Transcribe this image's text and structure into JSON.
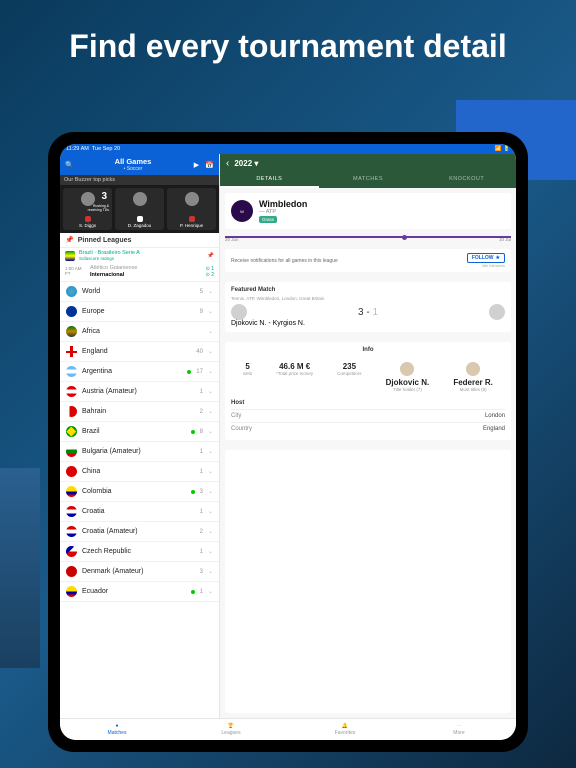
{
  "headline": "Find every tournament detail",
  "statusbar": {
    "time": "11:29 AM",
    "date": "Tue Sep 20"
  },
  "left": {
    "header": {
      "title": "All Games",
      "sub": "• Soccer"
    },
    "picks_label": "Our Buzzer top picks",
    "picks": [
      {
        "name": "S. Diggs",
        "badge": "3",
        "sub": "Rushing & receiving TDs",
        "crest": "#c33"
      },
      {
        "name": "D. Zagadou",
        "crest": "#fff"
      },
      {
        "name": "P. Henrique",
        "crest": "#c33"
      }
    ],
    "pinned_label": "Pinned Leagues",
    "pinned": {
      "country": "Brazil",
      "league": "Brasileiro Serie A",
      "src": "Sofascore ratings"
    },
    "match": {
      "time": "1:00 AM",
      "status": "FT",
      "home": "Atlético Goianiense",
      "away": "Internacional",
      "hs": "1",
      "as": "2"
    },
    "countries": [
      {
        "name": "World",
        "count": "5",
        "flag": "flag-world"
      },
      {
        "name": "Europe",
        "count": "9",
        "flag": "flag-eu"
      },
      {
        "name": "Africa",
        "count": "",
        "flag": "flag-af"
      },
      {
        "name": "England",
        "count": "40",
        "flag": "flag-en"
      },
      {
        "name": "Argentina",
        "count": "17",
        "flag": "flag-ar",
        "live": true
      },
      {
        "name": "Austria (Amateur)",
        "count": "1",
        "flag": "flag-at"
      },
      {
        "name": "Bahrain",
        "count": "2",
        "flag": "flag-bh"
      },
      {
        "name": "Brazil",
        "count": "8",
        "flag": "flag-br",
        "live": true
      },
      {
        "name": "Bulgaria (Amateur)",
        "count": "1",
        "flag": "flag-bg"
      },
      {
        "name": "China",
        "count": "1",
        "flag": "flag-cn"
      },
      {
        "name": "Colombia",
        "count": "3",
        "flag": "flag-co",
        "live": true
      },
      {
        "name": "Croatia",
        "count": "1",
        "flag": "flag-hr"
      },
      {
        "name": "Croatia (Amateur)",
        "count": "2",
        "flag": "flag-hr"
      },
      {
        "name": "Czech Republic",
        "count": "1",
        "flag": "flag-cz"
      },
      {
        "name": "Denmark (Amateur)",
        "count": "3",
        "flag": "flag-dk"
      },
      {
        "name": "Ecuador",
        "count": "1",
        "flag": "flag-ec",
        "live": true
      }
    ]
  },
  "right": {
    "year": "2022",
    "tabs": [
      "DETAILS",
      "MATCHES",
      "KNOCKOUT"
    ],
    "tourney": {
      "name": "Wimbledon",
      "org": "ATP",
      "surface": "Grass"
    },
    "timeline": {
      "start": "20 Jun",
      "end": "10 Jul"
    },
    "notif": {
      "text": "Receive notifications for all games in this league",
      "follow": "FOLLOW",
      "followers": "46k followers"
    },
    "featured": {
      "label": "Featured Match",
      "meta": "Tennis, ATP, Wimbledon, London, Great Britain",
      "players": "Djokovic N. - Kyrgios N.",
      "s1": "3",
      "s2": "1"
    },
    "info": {
      "label": "Info",
      "items": [
        {
          "val": "5",
          "lbl": "Sets"
        },
        {
          "val": "46.6 M €",
          "lbl": "*Total prize money"
        },
        {
          "val": "235",
          "lbl": "Competitors"
        },
        {
          "val": "Djokovic N.",
          "lbl": "Title holder (7)",
          "avatar": true
        },
        {
          "val": "Federer R.",
          "lbl": "Most titles (8)",
          "avatar": true
        }
      ],
      "host_label": "Host",
      "host": [
        {
          "k": "City",
          "v": "London"
        },
        {
          "k": "Country",
          "v": "England"
        }
      ]
    }
  },
  "bottom_tabs": [
    "Matches",
    "Leagues",
    "Favorites",
    "More"
  ]
}
